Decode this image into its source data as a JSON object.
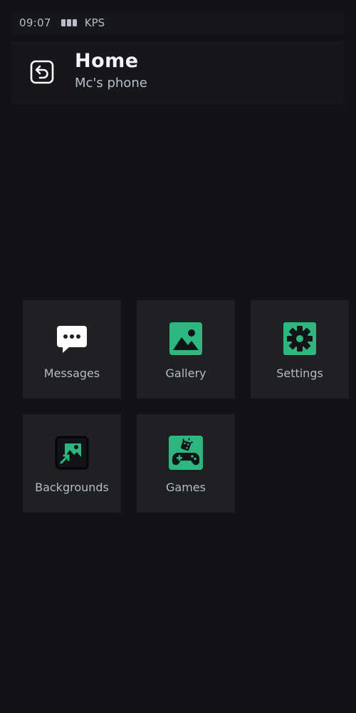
{
  "status_bar": {
    "time": "09:07",
    "carrier": "KPS",
    "signal_bars": 3
  },
  "header": {
    "title": "Home",
    "subtitle": "Mc's phone",
    "back_icon": "back-arrow-icon"
  },
  "apps": [
    {
      "label": "Messages",
      "icon": "chat-bubble-icon"
    },
    {
      "label": "Gallery",
      "icon": "image-icon"
    },
    {
      "label": "Settings",
      "icon": "gear-icon"
    },
    {
      "label": "Backgrounds",
      "icon": "wallpaper-icon"
    },
    {
      "label": "Games",
      "icon": "gamepad-icon"
    }
  ],
  "colors": {
    "background": "#111317",
    "tile": "#1f2024",
    "accent": "#2db77f"
  }
}
